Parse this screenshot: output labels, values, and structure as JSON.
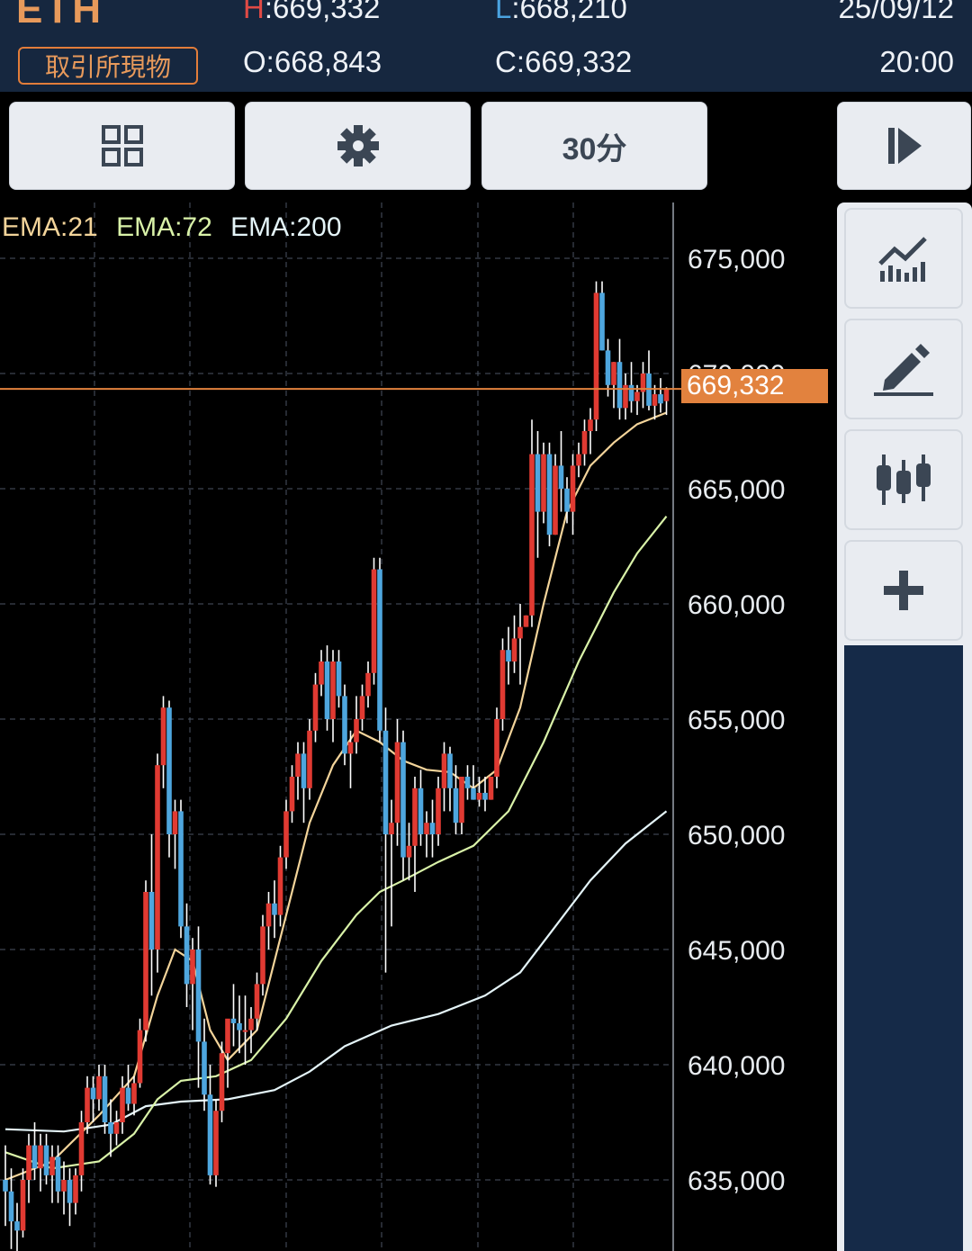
{
  "header": {
    "symbol": "ETH",
    "market": "取引所現物",
    "high_label": "H",
    "high_value": ":669,332",
    "low_label": "L",
    "low_value": ":668,210",
    "open": "O:668,843",
    "close": "C:669,332",
    "date": "25/09/12",
    "time": "20:00"
  },
  "toolbar": {
    "layout_icon": "grid-icon",
    "settings_icon": "gear-icon",
    "interval_label": "30分",
    "play_icon": "step-forward-icon"
  },
  "side_panel": {
    "buttons": [
      "indicator-chart-icon",
      "pencil-draw-icon",
      "candlestick-compare-icon",
      "plus-icon"
    ]
  },
  "legend": {
    "ema21": "EMA:21",
    "ema72": "EMA:72",
    "ema200": "EMA:200",
    "colors": {
      "ema21": "#f3d49a",
      "ema72": "#d9f2a8",
      "ema200": "#e4f4f8"
    }
  },
  "current_price": "669,332",
  "colors": {
    "up": "#e03a32",
    "down": "#4ea6de",
    "price_line": "#e2823e"
  },
  "chart_data": {
    "type": "candlestick",
    "y_ticks": [
      "675,000",
      "670,000",
      "665,000",
      "660,000",
      "655,000",
      "650,000",
      "645,000",
      "640,000",
      "635,000"
    ],
    "ylim": [
      632000,
      676500
    ],
    "current": 669332,
    "candles": [
      [
        635000,
        636500,
        633000,
        634500
      ],
      [
        634500,
        635500,
        632000,
        633200
      ],
      [
        633200,
        634000,
        631000,
        632800
      ],
      [
        632800,
        635500,
        632500,
        635000
      ],
      [
        635000,
        637000,
        634000,
        636500
      ],
      [
        636500,
        637500,
        635000,
        635500
      ],
      [
        635500,
        637000,
        634500,
        636500
      ],
      [
        636500,
        637000,
        634800,
        635200
      ],
      [
        635200,
        636500,
        634000,
        636000
      ],
      [
        636000,
        636500,
        634000,
        634500
      ],
      [
        634500,
        635800,
        633500,
        635000
      ],
      [
        635000,
        635500,
        633000,
        634000
      ],
      [
        634000,
        635500,
        633500,
        635200
      ],
      [
        635200,
        638000,
        634500,
        637500
      ],
      [
        637500,
        639500,
        637000,
        639000
      ],
      [
        639000,
        639500,
        637500,
        638500
      ],
      [
        638500,
        640000,
        638000,
        639500
      ],
      [
        639500,
        640000,
        637000,
        637500
      ],
      [
        637500,
        638500,
        636000,
        637000
      ],
      [
        637000,
        638000,
        636500,
        637500
      ],
      [
        637500,
        639500,
        637000,
        639000
      ],
      [
        639000,
        640000,
        638000,
        638300
      ],
      [
        638300,
        639500,
        637800,
        639200
      ],
      [
        639200,
        642000,
        639000,
        641500
      ],
      [
        641500,
        648000,
        641000,
        647500
      ],
      [
        647500,
        650000,
        643000,
        645000
      ],
      [
        645000,
        653500,
        644000,
        653000
      ],
      [
        653000,
        656000,
        652000,
        655500
      ],
      [
        655500,
        655800,
        649000,
        650000
      ],
      [
        650000,
        651500,
        648500,
        651000
      ],
      [
        651000,
        651500,
        645500,
        646000
      ],
      [
        646000,
        647000,
        642500,
        643500
      ],
      [
        643500,
        645500,
        641500,
        645000
      ],
      [
        645000,
        646000,
        639000,
        641000
      ],
      [
        641000,
        642000,
        638000,
        638700
      ],
      [
        638700,
        640000,
        634800,
        635200
      ],
      [
        635200,
        638500,
        634700,
        638000
      ],
      [
        638000,
        641000,
        637500,
        640500
      ],
      [
        640500,
        641500,
        639000,
        642000
      ],
      [
        642000,
        643500,
        640800,
        641800
      ],
      [
        641800,
        643000,
        640500,
        641500
      ],
      [
        641500,
        643000,
        640000,
        641500
      ],
      [
        641500,
        642500,
        640500,
        642000
      ],
      [
        642000,
        644000,
        641500,
        643500
      ],
      [
        643500,
        646500,
        643000,
        646000
      ],
      [
        646000,
        647500,
        645000,
        647000
      ],
      [
        647000,
        648000,
        645500,
        646500
      ],
      [
        646500,
        649500,
        646000,
        649000
      ],
      [
        649000,
        651500,
        648500,
        651000
      ],
      [
        651000,
        653000,
        650500,
        652500
      ],
      [
        652500,
        654000,
        651500,
        653500
      ],
      [
        653500,
        654000,
        650500,
        652000
      ],
      [
        652000,
        655000,
        651500,
        654500
      ],
      [
        654500,
        657000,
        654000,
        656500
      ],
      [
        656500,
        658000,
        656000,
        657500
      ],
      [
        657500,
        658200,
        654500,
        655000
      ],
      [
        655000,
        658000,
        654000,
        657500
      ],
      [
        657500,
        658000,
        655500,
        656000
      ],
      [
        656000,
        656500,
        653000,
        653500
      ],
      [
        653500,
        654500,
        652000,
        654000
      ],
      [
        654000,
        656000,
        653500,
        655000
      ],
      [
        655000,
        656500,
        654500,
        656000
      ],
      [
        656000,
        657500,
        655500,
        657000
      ],
      [
        657000,
        662000,
        656500,
        661500
      ],
      [
        661500,
        662000,
        654000,
        654500
      ],
      [
        654500,
        655500,
        644000,
        650000
      ],
      [
        650000,
        651500,
        646000,
        650500
      ],
      [
        650500,
        655000,
        649500,
        654000
      ],
      [
        654000,
        654500,
        648000,
        649000
      ],
      [
        649000,
        650500,
        648000,
        649500
      ],
      [
        649500,
        652500,
        647500,
        652000
      ],
      [
        652000,
        652800,
        649500,
        650000
      ],
      [
        650000,
        651000,
        649000,
        650500
      ],
      [
        650500,
        651500,
        649000,
        650000
      ],
      [
        650000,
        652500,
        649500,
        652000
      ],
      [
        652000,
        654000,
        651000,
        653500
      ],
      [
        653500,
        653800,
        651000,
        652000
      ],
      [
        652000,
        653000,
        650000,
        650500
      ],
      [
        650500,
        652500,
        650000,
        652500
      ],
      [
        652500,
        653000,
        651500,
        652000
      ],
      [
        652000,
        653000,
        651500,
        651500
      ],
      [
        651500,
        652500,
        651200,
        651800
      ],
      [
        651800,
        652500,
        651000,
        651500
      ],
      [
        651500,
        652500,
        651500,
        652500
      ],
      [
        652500,
        655500,
        652000,
        655000
      ],
      [
        655000,
        658500,
        654500,
        658000
      ],
      [
        658000,
        659000,
        656500,
        657500
      ],
      [
        657500,
        659500,
        657000,
        658500
      ],
      [
        658500,
        660000,
        656500,
        659000
      ],
      [
        659000,
        659500,
        659000,
        659500
      ],
      [
        659500,
        668000,
        659000,
        666500
      ],
      [
        666500,
        667500,
        662000,
        664000
      ],
      [
        664000,
        667000,
        663500,
        666500
      ],
      [
        666500,
        667000,
        662500,
        663000
      ],
      [
        663000,
        666500,
        663000,
        666000
      ],
      [
        666000,
        667500,
        664000,
        665000
      ],
      [
        665000,
        665500,
        663500,
        664000
      ],
      [
        664000,
        666500,
        663000,
        666000
      ],
      [
        666000,
        667000,
        665500,
        666500
      ],
      [
        666500,
        668000,
        666000,
        667500
      ],
      [
        667500,
        668500,
        666500,
        668000
      ],
      [
        668000,
        674000,
        667500,
        673500
      ],
      [
        673500,
        674000,
        671000,
        671000
      ],
      [
        671000,
        671500,
        669000,
        669500
      ],
      [
        669500,
        670500,
        668500,
        670500
      ],
      [
        670500,
        671500,
        668000,
        668500
      ],
      [
        668500,
        670000,
        668000,
        669500
      ],
      [
        669500,
        670500,
        668300,
        668800
      ],
      [
        668800,
        669500,
        668200,
        669200
      ],
      [
        669200,
        670500,
        668500,
        670000
      ],
      [
        670000,
        671000,
        668400,
        668600
      ],
      [
        668600,
        669500,
        668000,
        669100
      ],
      [
        669100,
        669800,
        668300,
        668700
      ],
      [
        668800,
        669400,
        668200,
        669332
      ]
    ],
    "ema21": [
      [
        0,
        635000
      ],
      [
        8,
        635800
      ],
      [
        16,
        637800
      ],
      [
        22,
        639500
      ],
      [
        26,
        643000
      ],
      [
        29,
        645000
      ],
      [
        32,
        644500
      ],
      [
        35,
        641500
      ],
      [
        38,
        640200
      ],
      [
        43,
        641500
      ],
      [
        48,
        646500
      ],
      [
        52,
        650500
      ],
      [
        56,
        653000
      ],
      [
        60,
        654500
      ],
      [
        64,
        654000
      ],
      [
        68,
        653200
      ],
      [
        72,
        652800
      ],
      [
        76,
        652700
      ],
      [
        80,
        652000
      ],
      [
        84,
        652800
      ],
      [
        88,
        655500
      ],
      [
        92,
        660000
      ],
      [
        96,
        664000
      ],
      [
        100,
        666000
      ],
      [
        104,
        667000
      ],
      [
        108,
        667800
      ],
      [
        113,
        668300
      ]
    ],
    "ema72": [
      [
        0,
        636200
      ],
      [
        8,
        635500
      ],
      [
        16,
        635800
      ],
      [
        22,
        637000
      ],
      [
        26,
        638500
      ],
      [
        30,
        639300
      ],
      [
        36,
        639500
      ],
      [
        42,
        640200
      ],
      [
        48,
        642000
      ],
      [
        54,
        644500
      ],
      [
        60,
        646500
      ],
      [
        64,
        647500
      ],
      [
        68,
        648000
      ],
      [
        74,
        648800
      ],
      [
        80,
        649500
      ],
      [
        86,
        651000
      ],
      [
        92,
        654000
      ],
      [
        98,
        657500
      ],
      [
        104,
        660500
      ],
      [
        108,
        662200
      ],
      [
        113,
        663800
      ]
    ],
    "ema200": [
      [
        0,
        637200
      ],
      [
        10,
        637100
      ],
      [
        18,
        637400
      ],
      [
        24,
        638200
      ],
      [
        30,
        638400
      ],
      [
        38,
        638500
      ],
      [
        46,
        638900
      ],
      [
        52,
        639700
      ],
      [
        58,
        640800
      ],
      [
        66,
        641700
      ],
      [
        74,
        642200
      ],
      [
        82,
        643000
      ],
      [
        88,
        644000
      ],
      [
        94,
        646000
      ],
      [
        100,
        648000
      ],
      [
        106,
        649600
      ],
      [
        113,
        651000
      ]
    ]
  }
}
